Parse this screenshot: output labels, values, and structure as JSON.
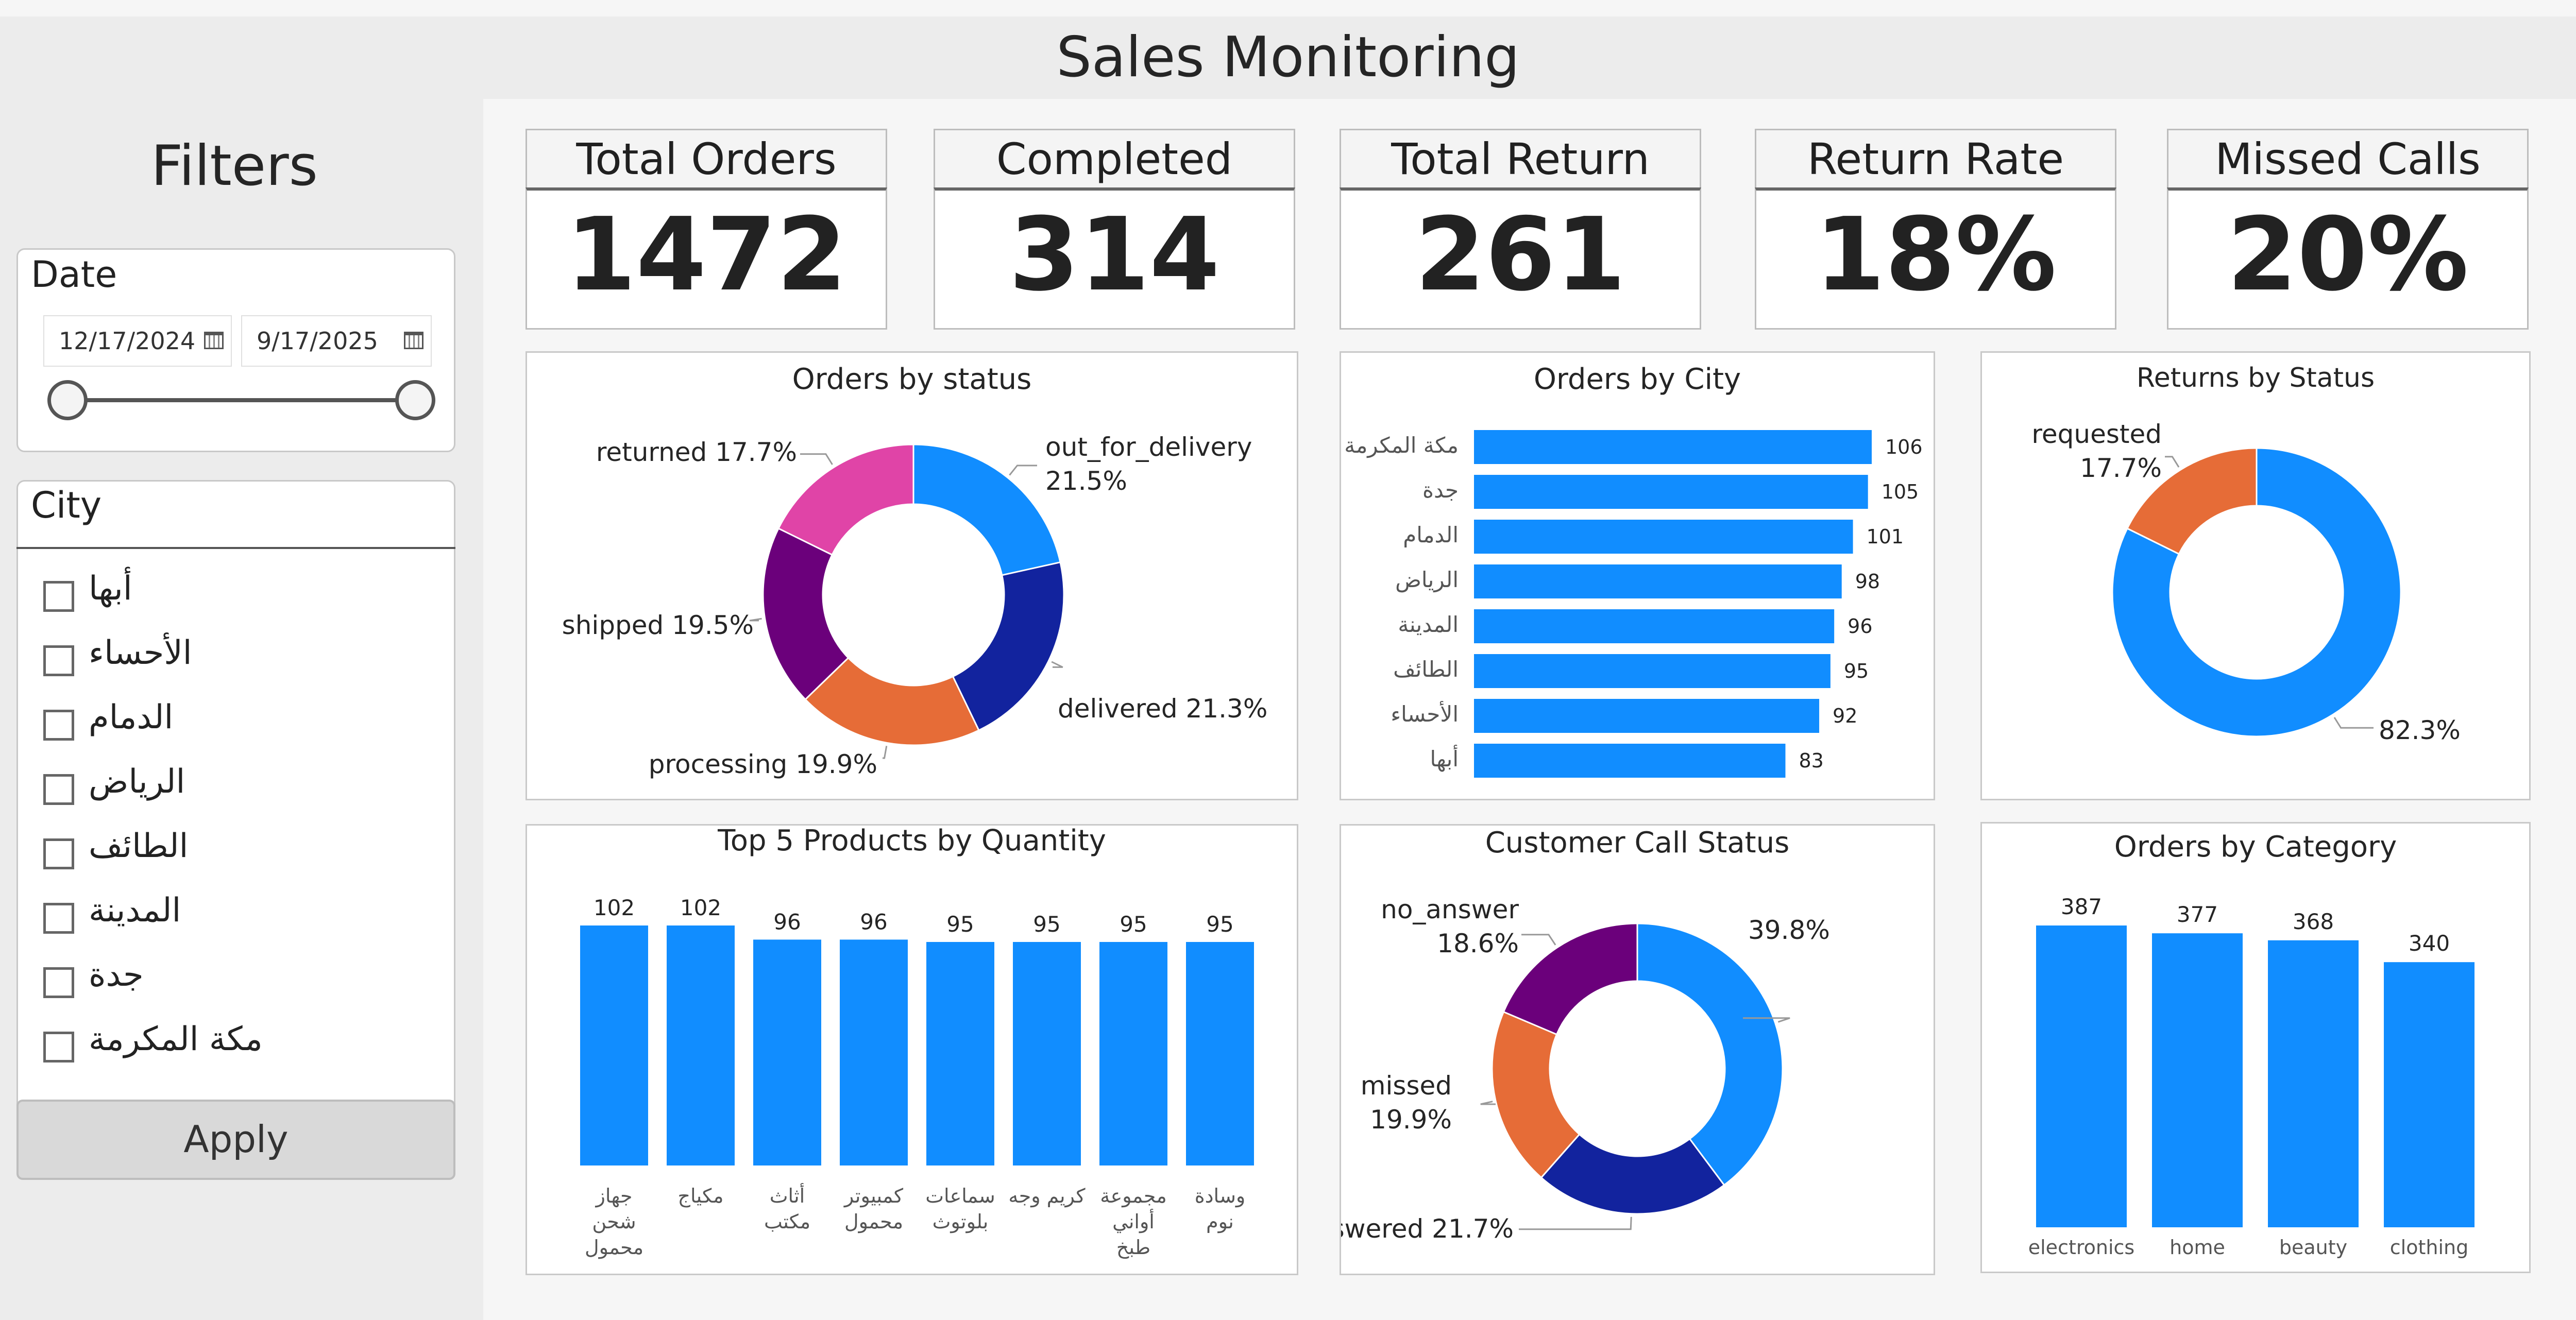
{
  "title": "Sales Monitoring",
  "filters": {
    "heading": "Filters",
    "date": {
      "label": "Date",
      "start": "12/17/2024",
      "end": "9/17/2025"
    },
    "city": {
      "label": "City",
      "options": [
        "أبها",
        "الأحساء",
        "الدمام",
        "الرياض",
        "الطائف",
        "المدينة",
        "جدة",
        "مكة المكرمة"
      ]
    },
    "apply_label": "Apply"
  },
  "kpis": [
    {
      "label": "Total Orders",
      "value": "1472"
    },
    {
      "label": "Completed Orders",
      "value": "314"
    },
    {
      "label": "Total Return",
      "value": "261"
    },
    {
      "label": "Return Rate",
      "value": "18%"
    },
    {
      "label": "Missed Calls",
      "value": "20%"
    }
  ],
  "colors": {
    "blue": "#118DFF",
    "navy": "#12239E",
    "orange": "#E66C37",
    "purple": "#6B007B",
    "pink": "#E044A7"
  },
  "chart_data": [
    {
      "id": "orders-by-status",
      "type": "pie",
      "donut": true,
      "title": "Orders by status",
      "slices": [
        {
          "label": "out_for_delivery",
          "value": 21.5,
          "text": "out_for_delivery",
          "pct": "21.5%",
          "color": "#118DFF"
        },
        {
          "label": "delivered",
          "value": 21.3,
          "text": "delivered 21.3%",
          "color": "#12239E"
        },
        {
          "label": "processing",
          "value": 19.9,
          "text": "processing 19.9%",
          "color": "#E66C37"
        },
        {
          "label": "shipped",
          "value": 19.5,
          "text": "shipped 19.5%",
          "color": "#6B007B"
        },
        {
          "label": "returned",
          "value": 17.7,
          "text": "returned 17.7%",
          "color": "#E044A7"
        }
      ]
    },
    {
      "id": "orders-by-city",
      "type": "bar",
      "orientation": "horizontal",
      "title": "Orders by City",
      "categories": [
        "مكة المكرمة",
        "جدة",
        "الدمام",
        "الرياض",
        "المدينة",
        "الطائف",
        "الأحساء",
        "أبها"
      ],
      "values": [
        106,
        105,
        101,
        98,
        96,
        95,
        92,
        83
      ],
      "color": "#118DFF"
    },
    {
      "id": "returns-by-status",
      "type": "pie",
      "donut": true,
      "title": "Returns by Status",
      "slices": [
        {
          "label": "",
          "value": 82.3,
          "pct": "82.3%",
          "color": "#118DFF"
        },
        {
          "label": "requested",
          "value": 17.7,
          "pct": "17.7%",
          "color": "#E66C37"
        }
      ]
    },
    {
      "id": "top-products",
      "type": "bar",
      "orientation": "vertical",
      "title": "Top 5 Products by Quantity",
      "categories": [
        [
          "جهاز",
          "شحن",
          "محمول"
        ],
        [
          "مكياج"
        ],
        [
          "أثاث",
          "مكتب"
        ],
        [
          "كمبيوتر",
          "محمول"
        ],
        [
          "سماعات",
          "بلوتوث"
        ],
        [
          "كريم وجه"
        ],
        [
          "مجموعة",
          "أواني",
          "طبخ"
        ],
        [
          "وسادة",
          "نوم"
        ]
      ],
      "values": [
        102,
        102,
        96,
        96,
        95,
        95,
        95,
        95
      ],
      "color": "#118DFF"
    },
    {
      "id": "customer-call-status",
      "type": "pie",
      "donut": true,
      "title": "Customer Call Status",
      "slices": [
        {
          "label": "",
          "value": 39.8,
          "pct": "39.8%",
          "color": "#118DFF"
        },
        {
          "label": "answered",
          "value": 21.7,
          "pct": "21.7%",
          "color": "#12239E"
        },
        {
          "label": "missed",
          "value": 19.9,
          "pct": "19.9%",
          "color": "#E66C37"
        },
        {
          "label": "no_answer",
          "value": 18.6,
          "pct": "18.6%",
          "color": "#6B007B"
        }
      ]
    },
    {
      "id": "orders-by-category",
      "type": "bar",
      "orientation": "vertical",
      "title": "Orders by Category",
      "categories": [
        "electronics",
        "home",
        "beauty",
        "clothing"
      ],
      "values": [
        387,
        377,
        368,
        340
      ],
      "color": "#118DFF"
    }
  ]
}
